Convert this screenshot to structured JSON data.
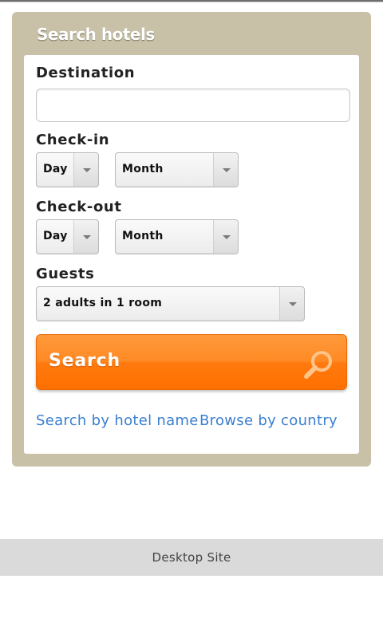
{
  "panel": {
    "title": "Search hotels"
  },
  "form": {
    "destination": {
      "label": "Destination",
      "value": "",
      "placeholder": ""
    },
    "checkin": {
      "label": "Check-in",
      "day": "Day",
      "month": "Month"
    },
    "checkout": {
      "label": "Check-out",
      "day": "Day",
      "month": "Month"
    },
    "guests": {
      "label": "Guests",
      "value": "2 adults in 1 room"
    },
    "search_button": {
      "label": "Search",
      "icon": "search-icon"
    }
  },
  "links": {
    "by_hotel_name": "Search by hotel name",
    "by_country": "Browse by country"
  },
  "footer": {
    "label": "Desktop Site"
  },
  "colors": {
    "panel": "#c8c1a7",
    "accent": "#ff7a0e",
    "link": "#3a7fd0",
    "footer": "#dadada"
  }
}
